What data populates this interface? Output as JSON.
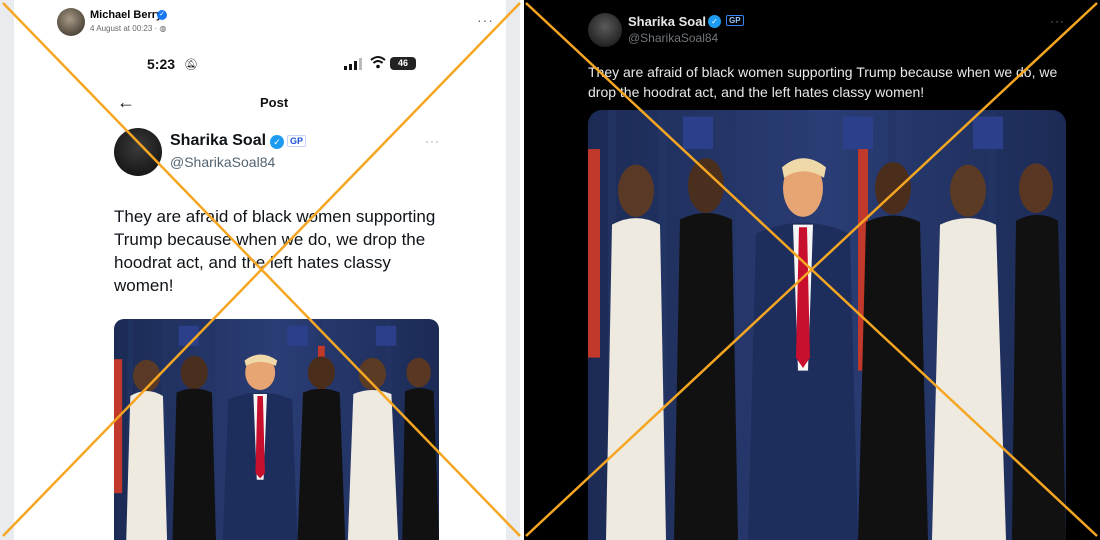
{
  "facebook_post": {
    "author_name": "Michael Berry",
    "timestamp": "4 August at 00:23 · ",
    "more_icon": "more-horizontal-icon"
  },
  "phone_status": {
    "time": "5:23",
    "battery": "46"
  },
  "phone_nav": {
    "title": "Post",
    "back_icon": "back-arrow-icon"
  },
  "tweet": {
    "display_name": "Sharika Soal",
    "badge": "GP",
    "handle": "@SharikaSoal84",
    "text": "They are afraid of black women supporting Trump because when we do, we drop the hoodrat act, and the left hates classy women!"
  },
  "tweet_dark": {
    "display_name": "Sharika Soal",
    "badge": "GP",
    "handle": "@SharikaSoal84",
    "text": "They are afraid of black women supporting Trump because when we do, we drop the hoodrat act, and the left hates classy women!"
  },
  "colors": {
    "cross_line": "#f5a623",
    "twitter_blue": "#1d9bf0",
    "facebook_blue": "#1877f2",
    "dark_bg": "#000000"
  }
}
